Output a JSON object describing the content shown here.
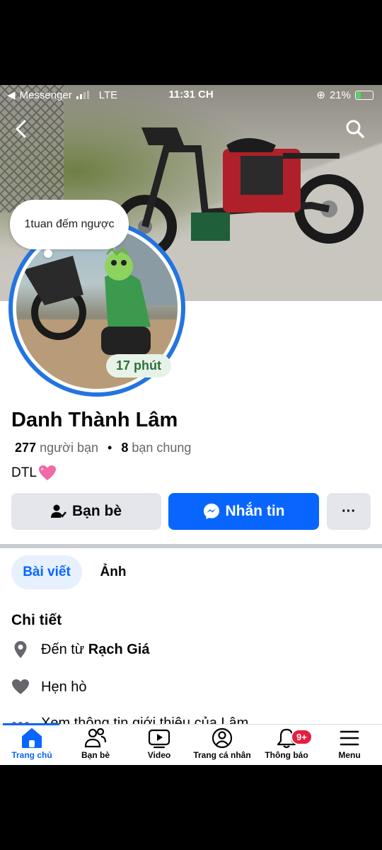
{
  "status_bar": {
    "back_app": "Messenger",
    "network": "LTE",
    "time": "11:31 CH",
    "battery": "21%"
  },
  "story": {
    "bubble_text": "1tuan đếm ngược",
    "timer": "17 phút"
  },
  "profile": {
    "name": "Danh Thành Lâm",
    "friend_count": "277",
    "friend_label": "người bạn",
    "separator": "•",
    "mutual_count": "8",
    "mutual_label": "bạn chung",
    "bio": "DTL"
  },
  "actions": {
    "friends": "Bạn bè",
    "message": "Nhắn tin",
    "more": "···"
  },
  "tabs": [
    {
      "label": "Bài viết",
      "active": true
    },
    {
      "label": "Ảnh",
      "active": false
    }
  ],
  "details": {
    "title": "Chi tiết",
    "from_prefix": "Đến từ",
    "from_place": "Rạch Giá",
    "relationship": "Hẹn hò",
    "more_info": "Xem thông tin giới thiệu của Lâm"
  },
  "bottom_nav": [
    {
      "label": "Trang chủ",
      "icon": "home-icon",
      "active": true
    },
    {
      "label": "Bạn bè",
      "icon": "friends-icon",
      "active": false
    },
    {
      "label": "Video",
      "icon": "video-icon",
      "active": false
    },
    {
      "label": "Trang cá nhân",
      "icon": "profile-icon",
      "active": false
    },
    {
      "label": "Thông báo",
      "icon": "bell-icon",
      "active": false,
      "badge": "9+"
    },
    {
      "label": "Menu",
      "icon": "menu-icon",
      "active": false
    }
  ],
  "colors": {
    "accent": "#0866ff",
    "story_ring": "#2374e1",
    "badge": "#e41e3f"
  }
}
